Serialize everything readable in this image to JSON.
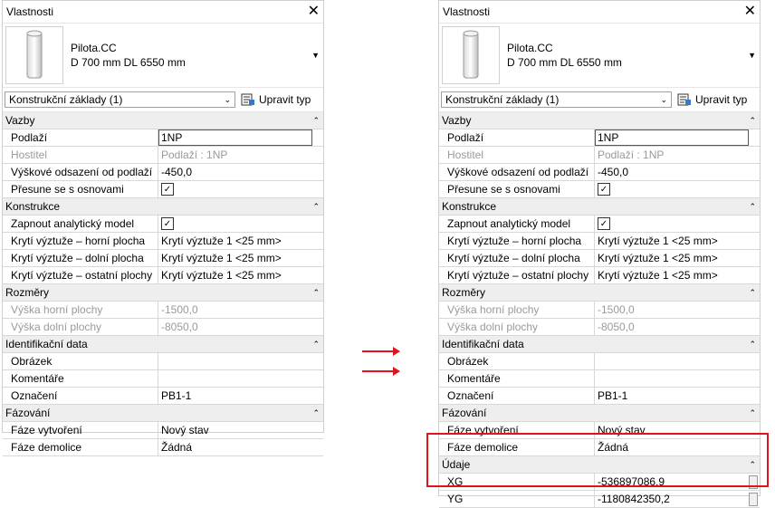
{
  "left": {
    "title": "Vlastnosti",
    "type_line1": "Pilota.CC",
    "type_line2": "D 700 mm DL 6550 mm",
    "instance_select": "Konstrukční základy (1)",
    "edit_type": "Upravit typ",
    "sections": [
      {
        "name": "Vazby",
        "rows": [
          {
            "k": "Podlaží",
            "v": "1NP",
            "kind": "input"
          },
          {
            "k": "Hostitel",
            "v": "Podlaží : 1NP",
            "kind": "disabled"
          },
          {
            "k": "Výškové odsazení od podlaží",
            "v": "-450,0",
            "kind": "text"
          },
          {
            "k": "Přesune se s osnovami",
            "v": "",
            "kind": "check"
          }
        ]
      },
      {
        "name": "Konstrukce",
        "rows": [
          {
            "k": "Zapnout analytický model",
            "v": "",
            "kind": "check"
          },
          {
            "k": "Krytí výztuže – horní plocha",
            "v": "Krytí výztuže 1 <25 mm>",
            "kind": "text"
          },
          {
            "k": "Krytí výztuže – dolní plocha",
            "v": "Krytí výztuže 1 <25 mm>",
            "kind": "text"
          },
          {
            "k": "Krytí výztuže – ostatní plochy",
            "v": "Krytí výztuže 1 <25 mm>",
            "kind": "text"
          }
        ]
      },
      {
        "name": "Rozměry",
        "rows": [
          {
            "k": "Výška horní plochy",
            "v": "-1500,0",
            "kind": "disabled"
          },
          {
            "k": "Výška dolní plochy",
            "v": "-8050,0",
            "kind": "disabled"
          }
        ]
      },
      {
        "name": "Identifikační data",
        "rows": [
          {
            "k": "Obrázek",
            "v": "",
            "kind": "text"
          },
          {
            "k": "Komentáře",
            "v": "",
            "kind": "text"
          },
          {
            "k": "Označení",
            "v": "PB1-1",
            "kind": "text"
          }
        ]
      },
      {
        "name": "Fázování",
        "rows": [
          {
            "k": "Fáze vytvoření",
            "v": "Nový stav",
            "kind": "text"
          },
          {
            "k": "Fáze demolice",
            "v": "Žádná",
            "kind": "text"
          }
        ]
      }
    ]
  },
  "right": {
    "title": "Vlastnosti",
    "type_line1": "Pilota.CC",
    "type_line2": "D 700 mm DL 6550 mm",
    "instance_select": "Konstrukční základy (1)",
    "edit_type": "Upravit typ",
    "sections": [
      {
        "name": "Vazby",
        "rows": [
          {
            "k": "Podlaží",
            "v": "1NP",
            "kind": "input"
          },
          {
            "k": "Hostitel",
            "v": "Podlaží : 1NP",
            "kind": "disabled"
          },
          {
            "k": "Výškové odsazení od podlaží",
            "v": "-450,0",
            "kind": "text"
          },
          {
            "k": "Přesune se s osnovami",
            "v": "",
            "kind": "check"
          }
        ]
      },
      {
        "name": "Konstrukce",
        "rows": [
          {
            "k": "Zapnout analytický model",
            "v": "",
            "kind": "check"
          },
          {
            "k": "Krytí výztuže – horní plocha",
            "v": "Krytí výztuže 1 <25 mm>",
            "kind": "text"
          },
          {
            "k": "Krytí výztuže – dolní plocha",
            "v": "Krytí výztuže 1 <25 mm>",
            "kind": "text"
          },
          {
            "k": "Krytí výztuže – ostatní plochy",
            "v": "Krytí výztuže 1 <25 mm>",
            "kind": "text"
          }
        ]
      },
      {
        "name": "Rozměry",
        "rows": [
          {
            "k": "Výška horní plochy",
            "v": "-1500,0",
            "kind": "disabled"
          },
          {
            "k": "Výška dolní plochy",
            "v": "-8050,0",
            "kind": "disabled"
          }
        ]
      },
      {
        "name": "Identifikační data",
        "rows": [
          {
            "k": "Obrázek",
            "v": "",
            "kind": "text"
          },
          {
            "k": "Komentáře",
            "v": "",
            "kind": "text"
          },
          {
            "k": "Označení",
            "v": "PB1-1",
            "kind": "text"
          }
        ]
      },
      {
        "name": "Fázování",
        "rows": [
          {
            "k": "Fáze vytvoření",
            "v": "Nový stav",
            "kind": "text"
          },
          {
            "k": "Fáze demolice",
            "v": "Žádná",
            "kind": "text"
          }
        ]
      },
      {
        "name": "Údaje",
        "rows": [
          {
            "k": "XG",
            "v": "-536897086,9",
            "kind": "text",
            "mini": true
          },
          {
            "k": "YG",
            "v": "-1180842350,2",
            "kind": "text",
            "mini": true
          }
        ]
      }
    ]
  },
  "colors": {
    "arrow": "#e0141e",
    "highlight_border": "#e0141e"
  },
  "icons": {
    "close": "close-icon",
    "collapse": "collapse-icon",
    "dropdown": "chevron-down-icon",
    "edit_type": "edit-type-icon"
  }
}
